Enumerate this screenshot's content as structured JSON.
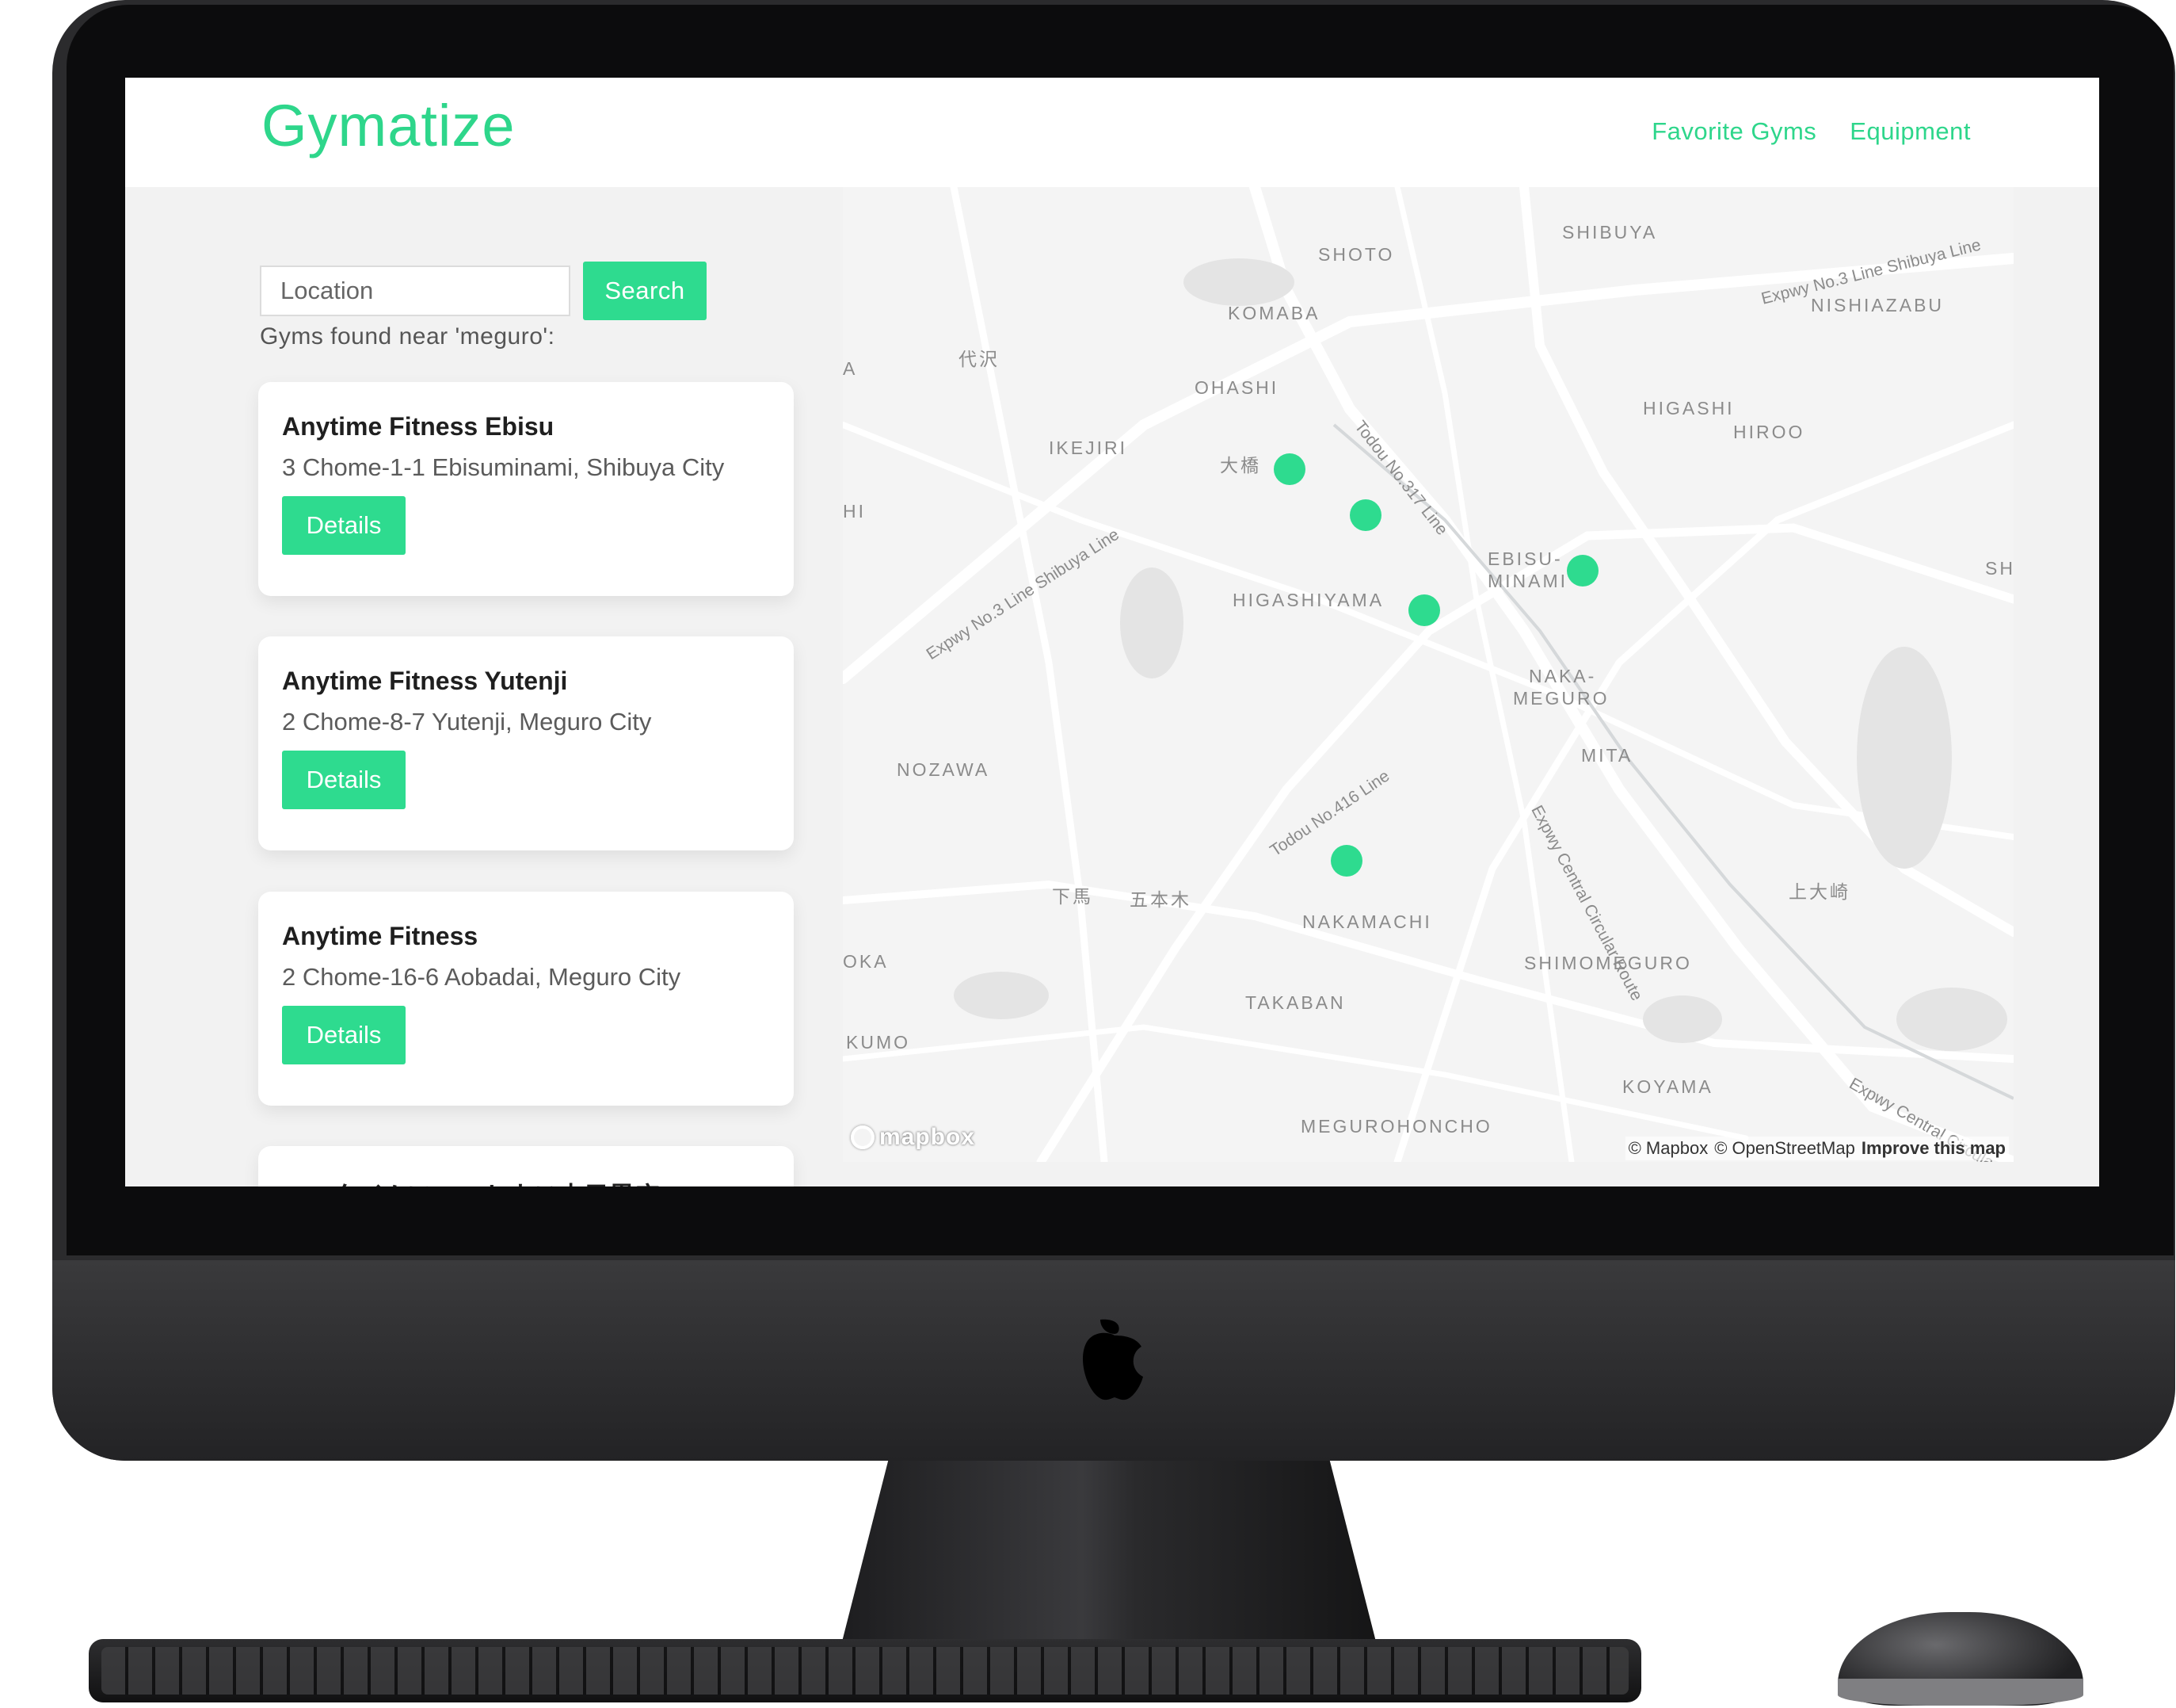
{
  "app": {
    "brand": "Gymatize",
    "nav": [
      "Favorite Gyms",
      "Equipment"
    ]
  },
  "search": {
    "placeholder": "Location",
    "button": "Search",
    "results_label": "Gyms found near 'meguro':"
  },
  "gyms": [
    {
      "name": "Anytime Fitness Ebisu",
      "address": "3 Chome-1-1 Ebisuminami, Shibuya City",
      "button": "Details"
    },
    {
      "name": "Anytime Fitness Yutenji",
      "address": "2 Chome-8-7 Yutenji, Meguro City",
      "button": "Details"
    },
    {
      "name": "Anytime Fitness",
      "address": "2 Chome-16-6 Aobadai, Meguro City",
      "button": "Details"
    },
    {
      "name": "エニタイムフィットネス中目黒店",
      "address": "",
      "button": ""
    }
  ],
  "map": {
    "districts": [
      "SHIBUYA",
      "SHOTO",
      "KOMABA",
      "NISHIAZABU",
      "代沢",
      "OHASHI",
      "HIGASHI",
      "HIROO",
      "IKEJIRI",
      "大橋",
      "EBISU-",
      "MINAMI",
      "HIGASHIYAMA",
      "NAKA-",
      "MEGURO",
      "NOZAWA",
      "MITA",
      "下馬",
      "五本木",
      "上大崎",
      "NAKAMACHI",
      "SHIMOMEGURO",
      "TAKABAN",
      "KOYAMA",
      "MEGUROHONCHO",
      "KUMO",
      "OKA",
      "HI",
      "A",
      "SH"
    ],
    "roads": [
      "Expwy No.3 Line Shibuya Line",
      "Expwy No.3 Line Shibuya Line",
      "Todou No.317 Line",
      "Todou No.416 Line",
      "Expwy Central Circular Route",
      "Expwy Central Circula"
    ],
    "marker_count": 5,
    "logo": "mapbox",
    "attribution": {
      "mapbox": "© Mapbox",
      "osm": "© OpenStreetMap",
      "improve": "Improve this map"
    }
  },
  "colors": {
    "accent": "#2edb8f",
    "brand": "#2ed68b"
  }
}
